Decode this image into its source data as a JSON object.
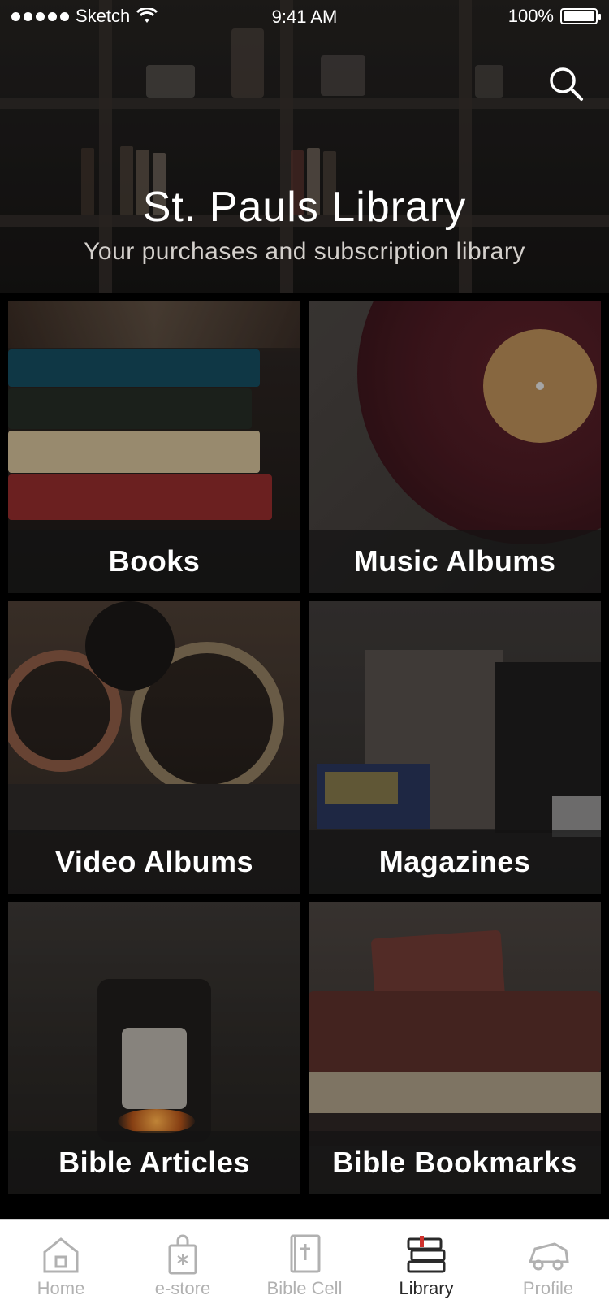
{
  "status_bar": {
    "carrier": "Sketch",
    "time": "9:41 AM",
    "battery": "100%"
  },
  "header": {
    "title": "St. Pauls Library",
    "subtitle": "Your purchases and subscription library",
    "search_icon": "search-icon"
  },
  "categories": [
    {
      "label": "Books"
    },
    {
      "label": "Music Albums"
    },
    {
      "label": "Video Albums"
    },
    {
      "label": "Magazines"
    },
    {
      "label": "Bible Articles"
    },
    {
      "label": "Bible Bookmarks"
    }
  ],
  "tabbar": {
    "items": [
      {
        "label": "Home",
        "icon": "home-icon"
      },
      {
        "label": "e-store",
        "icon": "shopping-bag-icon"
      },
      {
        "label": "Bible Cell",
        "icon": "bible-icon"
      },
      {
        "label": "Library",
        "icon": "library-books-icon"
      },
      {
        "label": "Profile",
        "icon": "car-profile-icon"
      }
    ],
    "active": "Library"
  },
  "colors": {
    "tab_inactive": "#b1b1b1",
    "tab_active": "#2a2a2a",
    "bookmark_accent": "#d0312d"
  }
}
